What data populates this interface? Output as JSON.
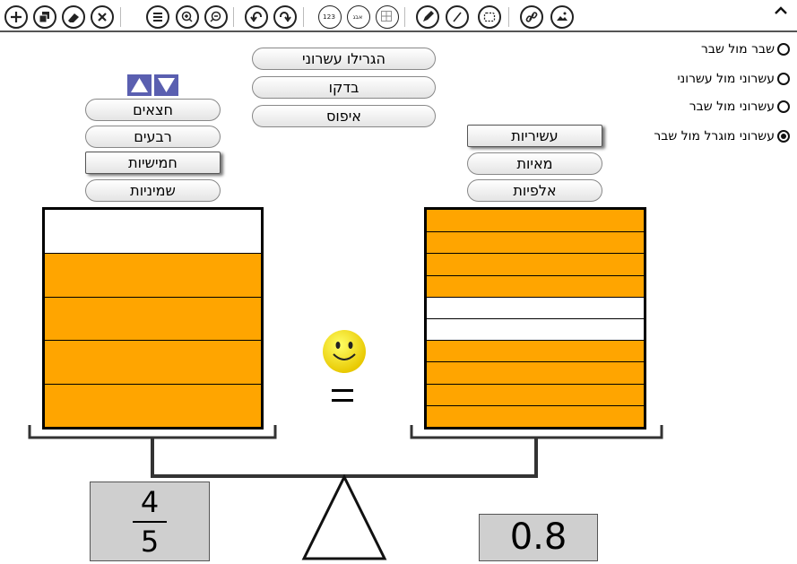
{
  "toolbar": {
    "tools": [
      "add-icon",
      "layers-icon",
      "eraser-icon",
      "close-icon",
      "menu-icon",
      "zoom-in-icon",
      "zoom-out-icon",
      "undo-icon",
      "redo-icon",
      "numbers-icon",
      "letters-icon",
      "grid-icon",
      "pencil-icon",
      "line-icon",
      "selection-icon",
      "link-icon",
      "image-icon"
    ],
    "numbers_label": "123",
    "letters_label": "אבג"
  },
  "actions": {
    "randomize": "הגרילו עשרוני",
    "check": "בדקו",
    "reset": "איפוס"
  },
  "modes": {
    "options": [
      {
        "label": "שבר מול שבר",
        "checked": false
      },
      {
        "label": "עשרוני מול עשרוני",
        "checked": false
      },
      {
        "label": "עשרוני מול שבר",
        "checked": false
      },
      {
        "label": "עשרוני מוגרל מול שבר",
        "checked": true
      }
    ]
  },
  "left_units": {
    "options": [
      "חצאים",
      "רבעים",
      "חמישיות",
      "שמיניות"
    ],
    "selected": "חמישיות"
  },
  "right_units": {
    "options": [
      "עשיריות",
      "מאיות",
      "אלפיות"
    ],
    "selected": "עשיריות"
  },
  "left_container": {
    "total_parts": 5,
    "filled_parts": 4
  },
  "right_container": {
    "total_parts": 10,
    "filled_pattern": [
      1,
      1,
      1,
      1,
      0,
      0,
      1,
      1,
      1,
      1
    ]
  },
  "left_value": {
    "numerator": "4",
    "denominator": "5"
  },
  "right_value": "0.8",
  "comparison_sign": "=",
  "feedback": "smiley-icon",
  "colors": {
    "fill": "#ffa500",
    "readout_bg": "#cfcfcf",
    "arrows": "#5a5fb0"
  }
}
